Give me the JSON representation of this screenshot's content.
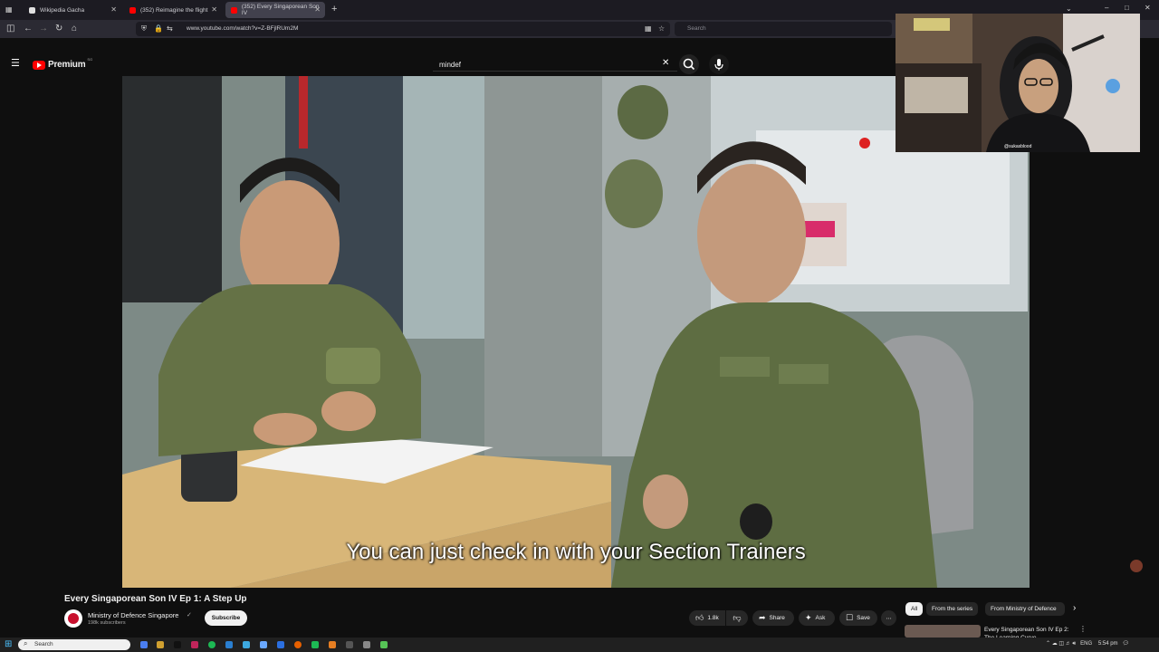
{
  "browser": {
    "tabs": [
      {
        "label": "Wikipedia Gacha",
        "active": false
      },
      {
        "label": "(352) Reimagine the flight",
        "active": false
      },
      {
        "label": "(352) Every Singaporean Son IV",
        "active": true
      }
    ],
    "new_tab": "+",
    "url": "www.youtube.com/watch?v=Z-BFjlRUm2M",
    "search_placeholder": "Search"
  },
  "youtube": {
    "logo_text": "Premium",
    "logo_badge": "SG",
    "search_query": "mindef",
    "video": {
      "subtitle": "You can just check in with your Section Trainers"
    },
    "title": "Every Singaporean Son IV Ep 1: A Step Up",
    "channel": {
      "name": "Ministry of Defence Singapore",
      "subscribers": "198k subscribers",
      "subscribe_label": "Subscribe"
    },
    "actions": {
      "likes": "1.8k",
      "share": "Share",
      "ask": "Ask",
      "save": "Save",
      "more": "⋯"
    },
    "chips": [
      "All",
      "From the series",
      "From Ministry of Defence"
    ],
    "related": {
      "title": "Every Singaporean Son IV Ep 2: The Learning Curve"
    }
  },
  "webcam": {
    "handle": "@sukasblood"
  },
  "taskbar": {
    "search": "Search",
    "language": "ENG",
    "time": "5:54 pm"
  },
  "colors": {
    "yt_red": "#ff0000",
    "background": "#0f0f0f"
  }
}
